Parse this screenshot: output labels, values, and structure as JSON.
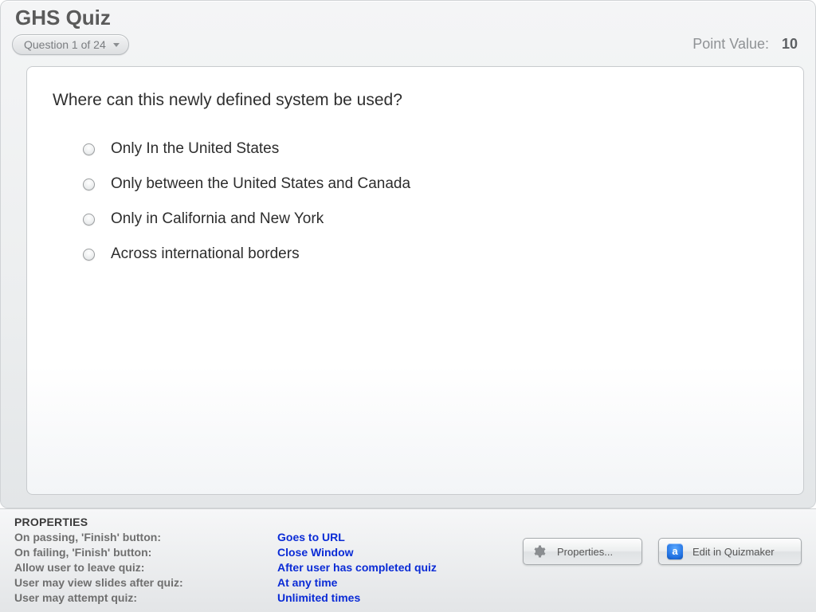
{
  "quiz": {
    "title": "GHS Quiz",
    "question_picker_label": "Question 1 of 24",
    "point_value_label": "Point Value:",
    "point_value": "10",
    "question_text": "Where can this newly defined system be used?",
    "options": [
      "Only In the United States",
      "Only between the United States and Canada",
      "Only in California and New York",
      "Across international borders"
    ]
  },
  "properties": {
    "title": "PROPERTIES",
    "rows": [
      {
        "key": "On passing, 'Finish' button:",
        "val": "Goes to URL"
      },
      {
        "key": "On failing, 'Finish' button:",
        "val": "Close Window"
      },
      {
        "key": "Allow user to leave quiz:",
        "val": "After user has completed quiz"
      },
      {
        "key": "User may view slides after quiz:",
        "val": "At any time"
      },
      {
        "key": "User may attempt quiz:",
        "val": "Unlimited times"
      }
    ],
    "properties_button": "Properties...",
    "edit_button": "Edit in Quizmaker",
    "app_icon_letter": "a"
  }
}
